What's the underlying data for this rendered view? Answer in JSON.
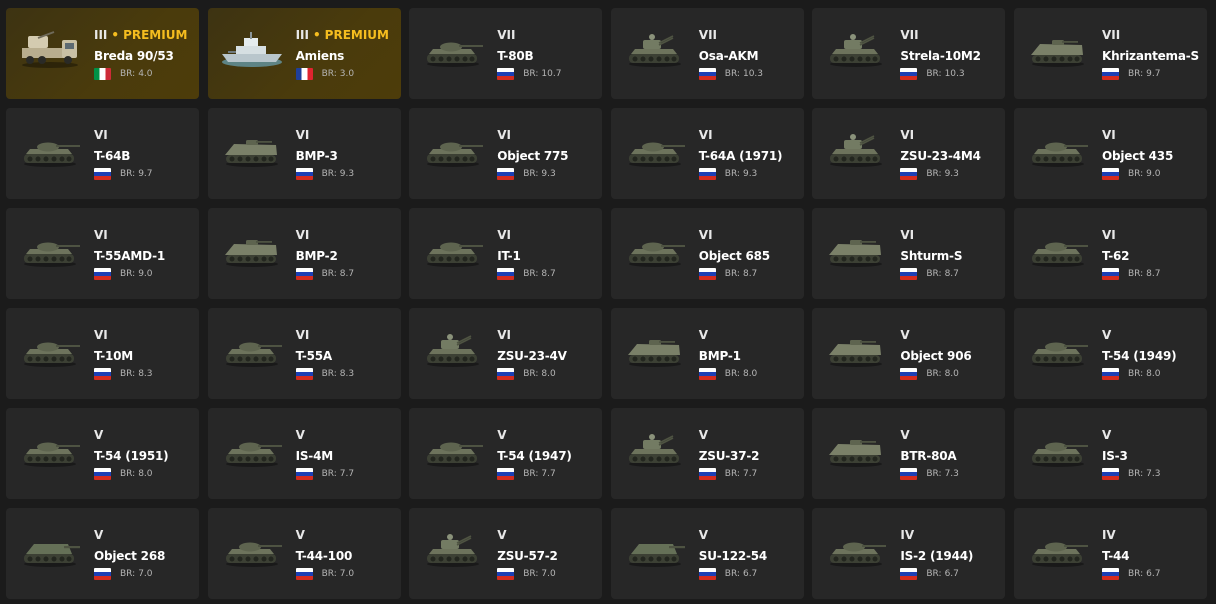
{
  "premium_label": "PREMIUM",
  "tier_separator": "•",
  "br_prefix": "BR:",
  "colors": {
    "card_bg": "#272727",
    "premium_bg": "#4a3b0c",
    "premium_text": "#f5bd1f",
    "page_bg": "#1b1b1b"
  },
  "vehicles": [
    {
      "tier": "III",
      "premium": true,
      "name": "Breda 90/53",
      "nation": "italy",
      "flag_icon": "italy-flag-icon",
      "br": "4.0",
      "icon": "truck-aa-icon"
    },
    {
      "tier": "III",
      "premium": true,
      "name": "Amiens",
      "nation": "france",
      "flag_icon": "france-flag-icon",
      "br": "3.0",
      "icon": "ship-icon"
    },
    {
      "tier": "VII",
      "premium": false,
      "name": "T-80B",
      "nation": "ussr",
      "flag_icon": "russia-flag-icon",
      "br": "10.7",
      "icon": "tank-icon"
    },
    {
      "tier": "VII",
      "premium": false,
      "name": "Osa-AKM",
      "nation": "ussr",
      "flag_icon": "russia-flag-icon",
      "br": "10.3",
      "icon": "spaa-icon"
    },
    {
      "tier": "VII",
      "premium": false,
      "name": "Strela-10M2",
      "nation": "ussr",
      "flag_icon": "russia-flag-icon",
      "br": "10.3",
      "icon": "spaa-icon"
    },
    {
      "tier": "VII",
      "premium": false,
      "name": "Khrizantema-S",
      "nation": "ussr",
      "flag_icon": "russia-flag-icon",
      "br": "9.7",
      "icon": "ifv-icon"
    },
    {
      "tier": "VI",
      "premium": false,
      "name": "T-64B",
      "nation": "ussr",
      "flag_icon": "russia-flag-icon",
      "br": "9.7",
      "icon": "tank-icon"
    },
    {
      "tier": "VI",
      "premium": false,
      "name": "BMP-3",
      "nation": "ussr",
      "flag_icon": "russia-flag-icon",
      "br": "9.3",
      "icon": "ifv-icon"
    },
    {
      "tier": "VI",
      "premium": false,
      "name": "Object 775",
      "nation": "ussr",
      "flag_icon": "russia-flag-icon",
      "br": "9.3",
      "icon": "tank-icon"
    },
    {
      "tier": "VI",
      "premium": false,
      "name": "T-64A (1971)",
      "nation": "ussr",
      "flag_icon": "russia-flag-icon",
      "br": "9.3",
      "icon": "tank-icon"
    },
    {
      "tier": "VI",
      "premium": false,
      "name": "ZSU-23-4M4",
      "nation": "ussr",
      "flag_icon": "russia-flag-icon",
      "br": "9.3",
      "icon": "spaa-icon"
    },
    {
      "tier": "VI",
      "premium": false,
      "name": "Object 435",
      "nation": "ussr",
      "flag_icon": "russia-flag-icon",
      "br": "9.0",
      "icon": "tank-icon"
    },
    {
      "tier": "VI",
      "premium": false,
      "name": "T-55AMD-1",
      "nation": "ussr",
      "flag_icon": "russia-flag-icon",
      "br": "9.0",
      "icon": "tank-icon"
    },
    {
      "tier": "VI",
      "premium": false,
      "name": "BMP-2",
      "nation": "ussr",
      "flag_icon": "russia-flag-icon",
      "br": "8.7",
      "icon": "ifv-icon"
    },
    {
      "tier": "VI",
      "premium": false,
      "name": "IT-1",
      "nation": "ussr",
      "flag_icon": "russia-flag-icon",
      "br": "8.7",
      "icon": "tank-icon"
    },
    {
      "tier": "VI",
      "premium": false,
      "name": "Object 685",
      "nation": "ussr",
      "flag_icon": "russia-flag-icon",
      "br": "8.7",
      "icon": "tank-icon"
    },
    {
      "tier": "VI",
      "premium": false,
      "name": "Shturm-S",
      "nation": "ussr",
      "flag_icon": "russia-flag-icon",
      "br": "8.7",
      "icon": "ifv-icon"
    },
    {
      "tier": "VI",
      "premium": false,
      "name": "T-62",
      "nation": "ussr",
      "flag_icon": "russia-flag-icon",
      "br": "8.7",
      "icon": "tank-icon"
    },
    {
      "tier": "VI",
      "premium": false,
      "name": "T-10M",
      "nation": "ussr",
      "flag_icon": "russia-flag-icon",
      "br": "8.3",
      "icon": "tank-icon"
    },
    {
      "tier": "VI",
      "premium": false,
      "name": "T-55A",
      "nation": "ussr",
      "flag_icon": "russia-flag-icon",
      "br": "8.3",
      "icon": "tank-icon"
    },
    {
      "tier": "VI",
      "premium": false,
      "name": "ZSU-23-4V",
      "nation": "ussr",
      "flag_icon": "russia-flag-icon",
      "br": "8.0",
      "icon": "spaa-icon"
    },
    {
      "tier": "V",
      "premium": false,
      "name": "BMP-1",
      "nation": "ussr",
      "flag_icon": "russia-flag-icon",
      "br": "8.0",
      "icon": "ifv-icon"
    },
    {
      "tier": "V",
      "premium": false,
      "name": "Object 906",
      "nation": "ussr",
      "flag_icon": "russia-flag-icon",
      "br": "8.0",
      "icon": "ifv-icon"
    },
    {
      "tier": "V",
      "premium": false,
      "name": "T-54 (1949)",
      "nation": "ussr",
      "flag_icon": "russia-flag-icon",
      "br": "8.0",
      "icon": "tank-icon"
    },
    {
      "tier": "V",
      "premium": false,
      "name": "T-54 (1951)",
      "nation": "ussr",
      "flag_icon": "russia-flag-icon",
      "br": "8.0",
      "icon": "tank-icon"
    },
    {
      "tier": "V",
      "premium": false,
      "name": "IS-4M",
      "nation": "ussr",
      "flag_icon": "russia-flag-icon",
      "br": "7.7",
      "icon": "tank-icon"
    },
    {
      "tier": "V",
      "premium": false,
      "name": "T-54 (1947)",
      "nation": "ussr",
      "flag_icon": "russia-flag-icon",
      "br": "7.7",
      "icon": "tank-icon"
    },
    {
      "tier": "V",
      "premium": false,
      "name": "ZSU-37-2",
      "nation": "ussr",
      "flag_icon": "russia-flag-icon",
      "br": "7.7",
      "icon": "spaa-icon"
    },
    {
      "tier": "V",
      "premium": false,
      "name": "BTR-80A",
      "nation": "ussr",
      "flag_icon": "russia-flag-icon",
      "br": "7.3",
      "icon": "ifv-icon"
    },
    {
      "tier": "V",
      "premium": false,
      "name": "IS-3",
      "nation": "ussr",
      "flag_icon": "russia-flag-icon",
      "br": "7.3",
      "icon": "tank-icon"
    },
    {
      "tier": "V",
      "premium": false,
      "name": "Object 268",
      "nation": "ussr",
      "flag_icon": "russia-flag-icon",
      "br": "7.0",
      "icon": "tank-destroyer-icon"
    },
    {
      "tier": "V",
      "premium": false,
      "name": "T-44-100",
      "nation": "ussr",
      "flag_icon": "russia-flag-icon",
      "br": "7.0",
      "icon": "tank-icon"
    },
    {
      "tier": "V",
      "premium": false,
      "name": "ZSU-57-2",
      "nation": "ussr",
      "flag_icon": "russia-flag-icon",
      "br": "7.0",
      "icon": "spaa-icon"
    },
    {
      "tier": "V",
      "premium": false,
      "name": "SU-122-54",
      "nation": "ussr",
      "flag_icon": "russia-flag-icon",
      "br": "6.7",
      "icon": "tank-destroyer-icon"
    },
    {
      "tier": "IV",
      "premium": false,
      "name": "IS-2 (1944)",
      "nation": "ussr",
      "flag_icon": "russia-flag-icon",
      "br": "6.7",
      "icon": "tank-icon"
    },
    {
      "tier": "IV",
      "premium": false,
      "name": "T-44",
      "nation": "ussr",
      "flag_icon": "russia-flag-icon",
      "br": "6.7",
      "icon": "tank-icon"
    }
  ]
}
